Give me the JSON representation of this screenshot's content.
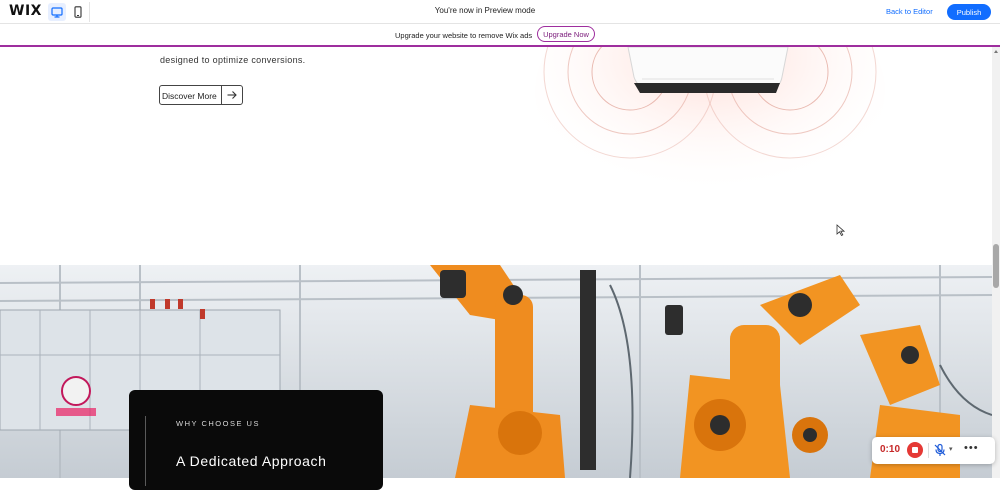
{
  "topbar": {
    "logo": "WIX",
    "preview_message": "You're now in Preview mode",
    "back_to_editor": "Back to Editor",
    "publish": "Publish",
    "accent_color": "#116dff"
  },
  "banner": {
    "message": "Upgrade your website to remove Wix ads",
    "upgrade_button": "Upgrade Now",
    "accent_color": "#9e2e9e"
  },
  "hero": {
    "text_fragment": "designed to optimize conversions.",
    "discover_button": "Discover More"
  },
  "feature_card": {
    "eyebrow": "WHY CHOOSE US",
    "title": "A Dedicated Approach"
  },
  "recorder": {
    "time": "0:10"
  },
  "icons": {
    "desktop": "desktop-view-icon",
    "mobile": "mobile-view-icon",
    "arrow": "arrow-right-icon",
    "stop": "stop-record-icon",
    "mic": "mic-muted-icon",
    "more": "more-options-icon"
  }
}
